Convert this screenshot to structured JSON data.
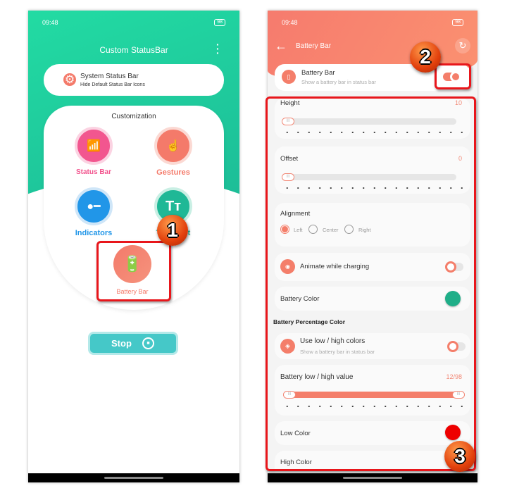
{
  "left_screen": {
    "status_time": "09:48",
    "status_right": "98",
    "title": "Custom StatusBar",
    "system_card": {
      "title": "System Status Bar",
      "subtitle": "Hide Default Status Bar Icons"
    },
    "customization_title": "Customization",
    "items": [
      {
        "label": "Status Bar",
        "color": "#f2568f"
      },
      {
        "label": "Gestures",
        "color": "#f47a6a"
      },
      {
        "label": "Indicators",
        "color": "#2196e8"
      },
      {
        "label": "Text Font",
        "color": "#1fb896"
      },
      {
        "label": "Battery Bar",
        "color": "#f47a6a"
      }
    ],
    "stop_label": "Stop",
    "accent": "#1ed6a0"
  },
  "right_screen": {
    "status_time": "09:48",
    "status_right": "98",
    "title": "Battery Bar",
    "accent": "#f47e6a",
    "battery_bar": {
      "title": "Battery Bar",
      "subtitle": "Show a battery bar in status bar",
      "enabled": true
    },
    "height": {
      "label": "Height",
      "value": "10"
    },
    "offset": {
      "label": "Offset",
      "value": "0"
    },
    "alignment": {
      "label": "Alignment",
      "options": [
        "Left",
        "Center",
        "Right"
      ],
      "selected": "Left"
    },
    "animate": {
      "label": "Animate while charging",
      "enabled": false
    },
    "battery_color": {
      "label": "Battery Color",
      "color": "#1fae88"
    },
    "section_heading": "Battery Percentage Color",
    "use_low_high": {
      "title": "Use low / high colors",
      "subtitle": "Show a battery bar in status bar",
      "enabled": false
    },
    "low_high_value": {
      "label": "Battery low / high value",
      "value": "12/98",
      "low": 12,
      "high": 98
    },
    "low_color": {
      "label": "Low Color",
      "color": "#ee0000"
    },
    "high_color": {
      "label": "High Color"
    }
  },
  "annotations": [
    "1",
    "2",
    "3"
  ]
}
